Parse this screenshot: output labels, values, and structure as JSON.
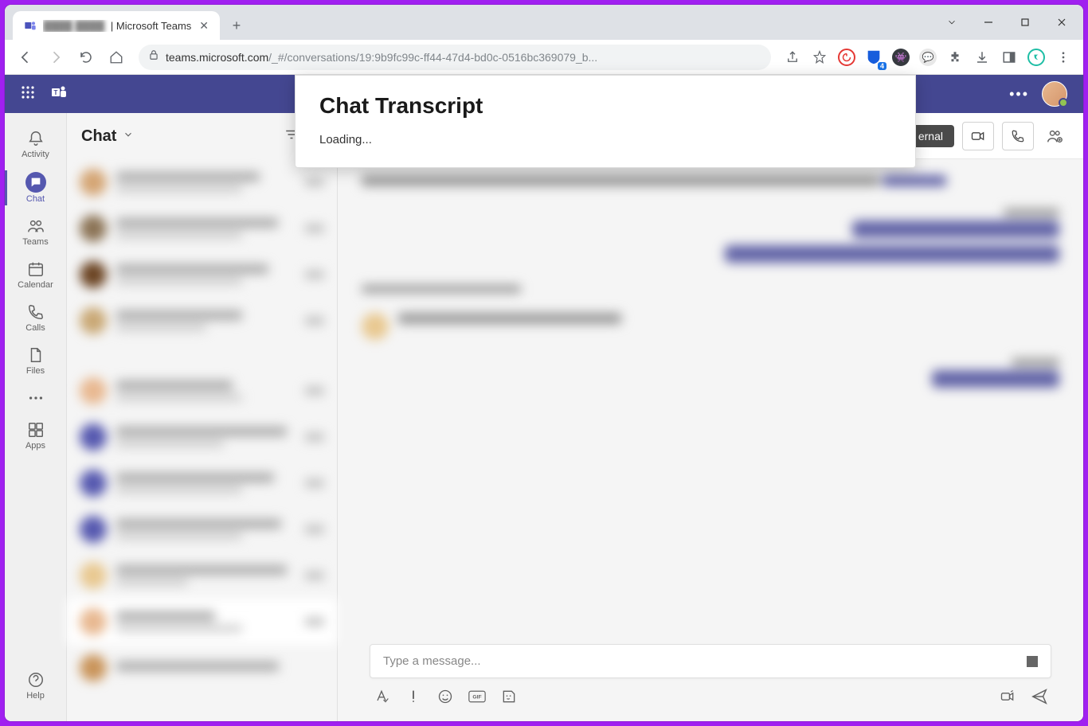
{
  "browser": {
    "tab_title_blurred": "████ ████",
    "tab_title_suffix": " | Microsoft Teams",
    "url_host": "teams.microsoft.com",
    "url_path": "/_#/conversations/19:9b9fc99c-ff44-47d4-bd0c-0516bc369079_b...",
    "extension_badge": "4"
  },
  "teams": {
    "rail": {
      "activity": "Activity",
      "chat": "Chat",
      "teams": "Teams",
      "calendar": "Calendar",
      "calls": "Calls",
      "files": "Files",
      "apps": "Apps",
      "help": "Help"
    },
    "chat_list_title": "Chat",
    "external_badge": "ernal",
    "compose_placeholder": "Type a message..."
  },
  "popup": {
    "title": "Chat Transcript",
    "status": "Loading..."
  }
}
